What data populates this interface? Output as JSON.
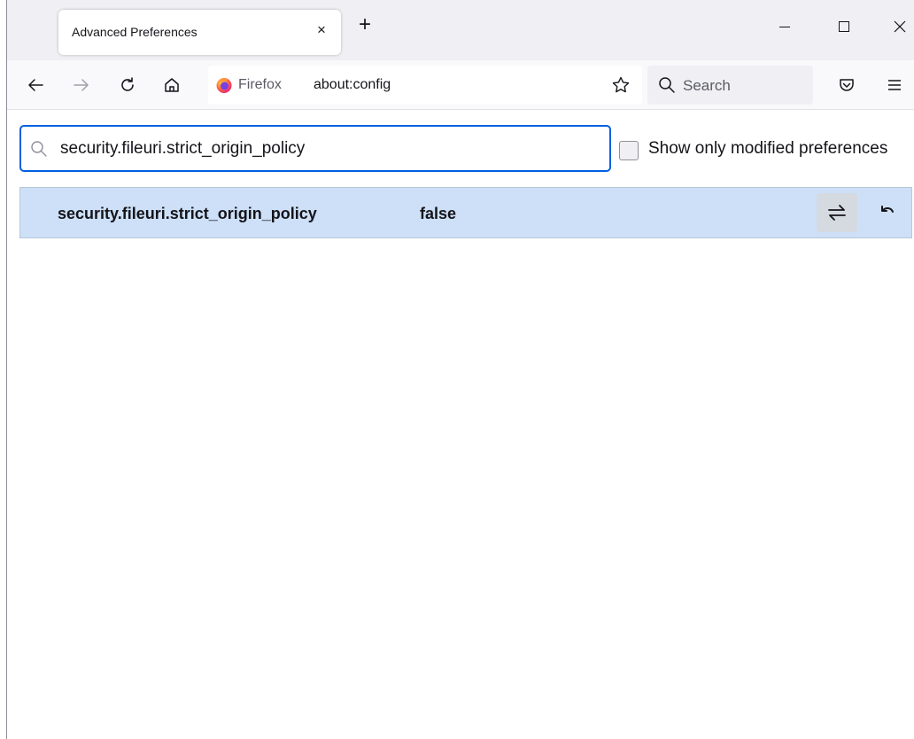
{
  "tab": {
    "title": "Advanced Preferences",
    "close_glyph": "×",
    "new_tab_glyph": "+"
  },
  "navbar": {
    "identity_label": "Firefox",
    "url": "about:config",
    "search_placeholder": "Search"
  },
  "config": {
    "filter_value": "security.fileuri.strict_origin_policy",
    "show_modified_label": "Show only modified preferences",
    "show_modified_checked": false,
    "preferences": [
      {
        "name": "security.fileuri.strict_origin_policy",
        "value": "false"
      }
    ]
  },
  "icons": {
    "back": "back-arrow-icon",
    "forward": "forward-arrow-icon",
    "reload": "reload-icon",
    "home": "home-icon",
    "bookmark": "star-icon",
    "pocket": "pocket-icon",
    "menu": "hamburger-menu-icon",
    "toggle": "toggle-icon",
    "reset": "reset-icon"
  },
  "colors": {
    "accent": "#0061e0",
    "row_highlight": "#cde0f7"
  }
}
